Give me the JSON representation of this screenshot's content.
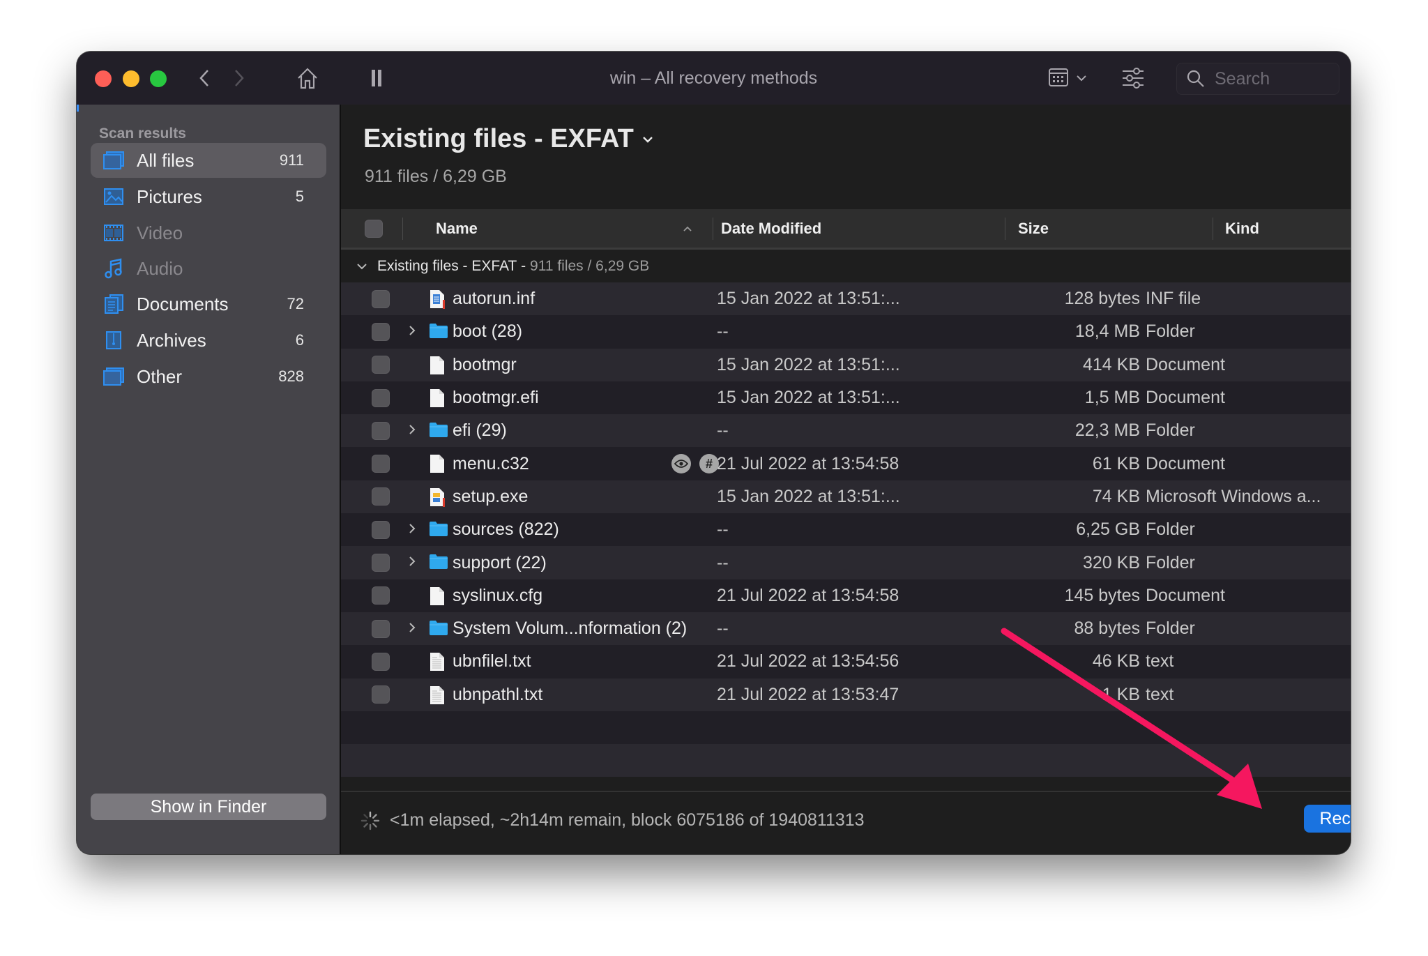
{
  "window": {
    "title": "win – All recovery methods",
    "search_placeholder": "Search"
  },
  "toolbar": {
    "back": "back-icon",
    "forward": "forward-icon",
    "home": "home-icon",
    "pause": "pause-icon",
    "view": "grid-view-icon",
    "filter": "sliders-icon"
  },
  "sidebar": {
    "heading": "Scan results",
    "items": [
      {
        "label": "All files",
        "count": "911",
        "icon": "all-files-icon",
        "selected": true,
        "dim": false
      },
      {
        "label": "Pictures",
        "count": "5",
        "icon": "pictures-icon",
        "selected": false,
        "dim": false
      },
      {
        "label": "Video",
        "count": "",
        "icon": "video-icon",
        "selected": false,
        "dim": true
      },
      {
        "label": "Audio",
        "count": "",
        "icon": "audio-icon",
        "selected": false,
        "dim": true
      },
      {
        "label": "Documents",
        "count": "72",
        "icon": "documents-icon",
        "selected": false,
        "dim": false
      },
      {
        "label": "Archives",
        "count": "6",
        "icon": "archives-icon",
        "selected": false,
        "dim": false
      },
      {
        "label": "Other",
        "count": "828",
        "icon": "other-icon",
        "selected": false,
        "dim": false
      }
    ],
    "show_in_finder": "Show in Finder"
  },
  "main": {
    "title": "Existing files - EXFAT",
    "subtitle": "911 files / 6,29 GB",
    "columns": {
      "name": "Name",
      "date": "Date Modified",
      "size": "Size",
      "kind": "Kind"
    },
    "group": {
      "label": "Existing files - EXFAT",
      "sep": " - ",
      "summary": "911 files / 6,29 GB"
    },
    "rows": [
      {
        "name": "autorun.inf",
        "date": "15 Jan 2022 at 13:51:...",
        "size": "128 bytes",
        "kind": "INF file",
        "type": "inf",
        "folder": false
      },
      {
        "name": "boot (28)",
        "date": "--",
        "size": "18,4 MB",
        "kind": "Folder",
        "type": "folder",
        "folder": true
      },
      {
        "name": "bootmgr",
        "date": "15 Jan 2022 at 13:51:...",
        "size": "414 KB",
        "kind": "Document",
        "type": "doc",
        "folder": false
      },
      {
        "name": "bootmgr.efi",
        "date": "15 Jan 2022 at 13:51:...",
        "size": "1,5 MB",
        "kind": "Document",
        "type": "doc",
        "folder": false
      },
      {
        "name": "efi (29)",
        "date": "--",
        "size": "22,3 MB",
        "kind": "Folder",
        "type": "folder",
        "folder": true
      },
      {
        "name": "menu.c32",
        "date": "21 Jul 2022 at 13:54:58",
        "size": "61 KB",
        "kind": "Document",
        "type": "doc",
        "folder": false,
        "badges": true
      },
      {
        "name": "setup.exe",
        "date": "15 Jan 2022 at 13:51:...",
        "size": "74 KB",
        "kind": "Microsoft Windows a...",
        "type": "exe",
        "folder": false
      },
      {
        "name": "sources (822)",
        "date": "--",
        "size": "6,25 GB",
        "kind": "Folder",
        "type": "folder",
        "folder": true
      },
      {
        "name": "support (22)",
        "date": "--",
        "size": "320 KB",
        "kind": "Folder",
        "type": "folder",
        "folder": true
      },
      {
        "name": "syslinux.cfg",
        "date": "21 Jul 2022 at 13:54:58",
        "size": "145 bytes",
        "kind": "Document",
        "type": "doc",
        "folder": false
      },
      {
        "name": "System Volum...nformation (2)",
        "date": "--",
        "size": "88 bytes",
        "kind": "Folder",
        "type": "folder",
        "folder": true
      },
      {
        "name": "ubnfilel.txt",
        "date": "21 Jul 2022 at 13:54:56",
        "size": "46 KB",
        "kind": "text",
        "type": "txt",
        "folder": false
      },
      {
        "name": "ubnpathl.txt",
        "date": "21 Jul 2022 at 13:53:47",
        "size": "1 KB",
        "kind": "text",
        "type": "txt",
        "folder": false
      }
    ]
  },
  "footer": {
    "status": "<1m elapsed, ~2h14m remain, block 6075186 of 1940811313",
    "recover": "Recover"
  },
  "colors": {
    "accent": "#1a73e0",
    "folder": "#2fa9ee",
    "sidebar_icon": "#2f8ff0",
    "annotation_arrow": "#f5175f"
  }
}
